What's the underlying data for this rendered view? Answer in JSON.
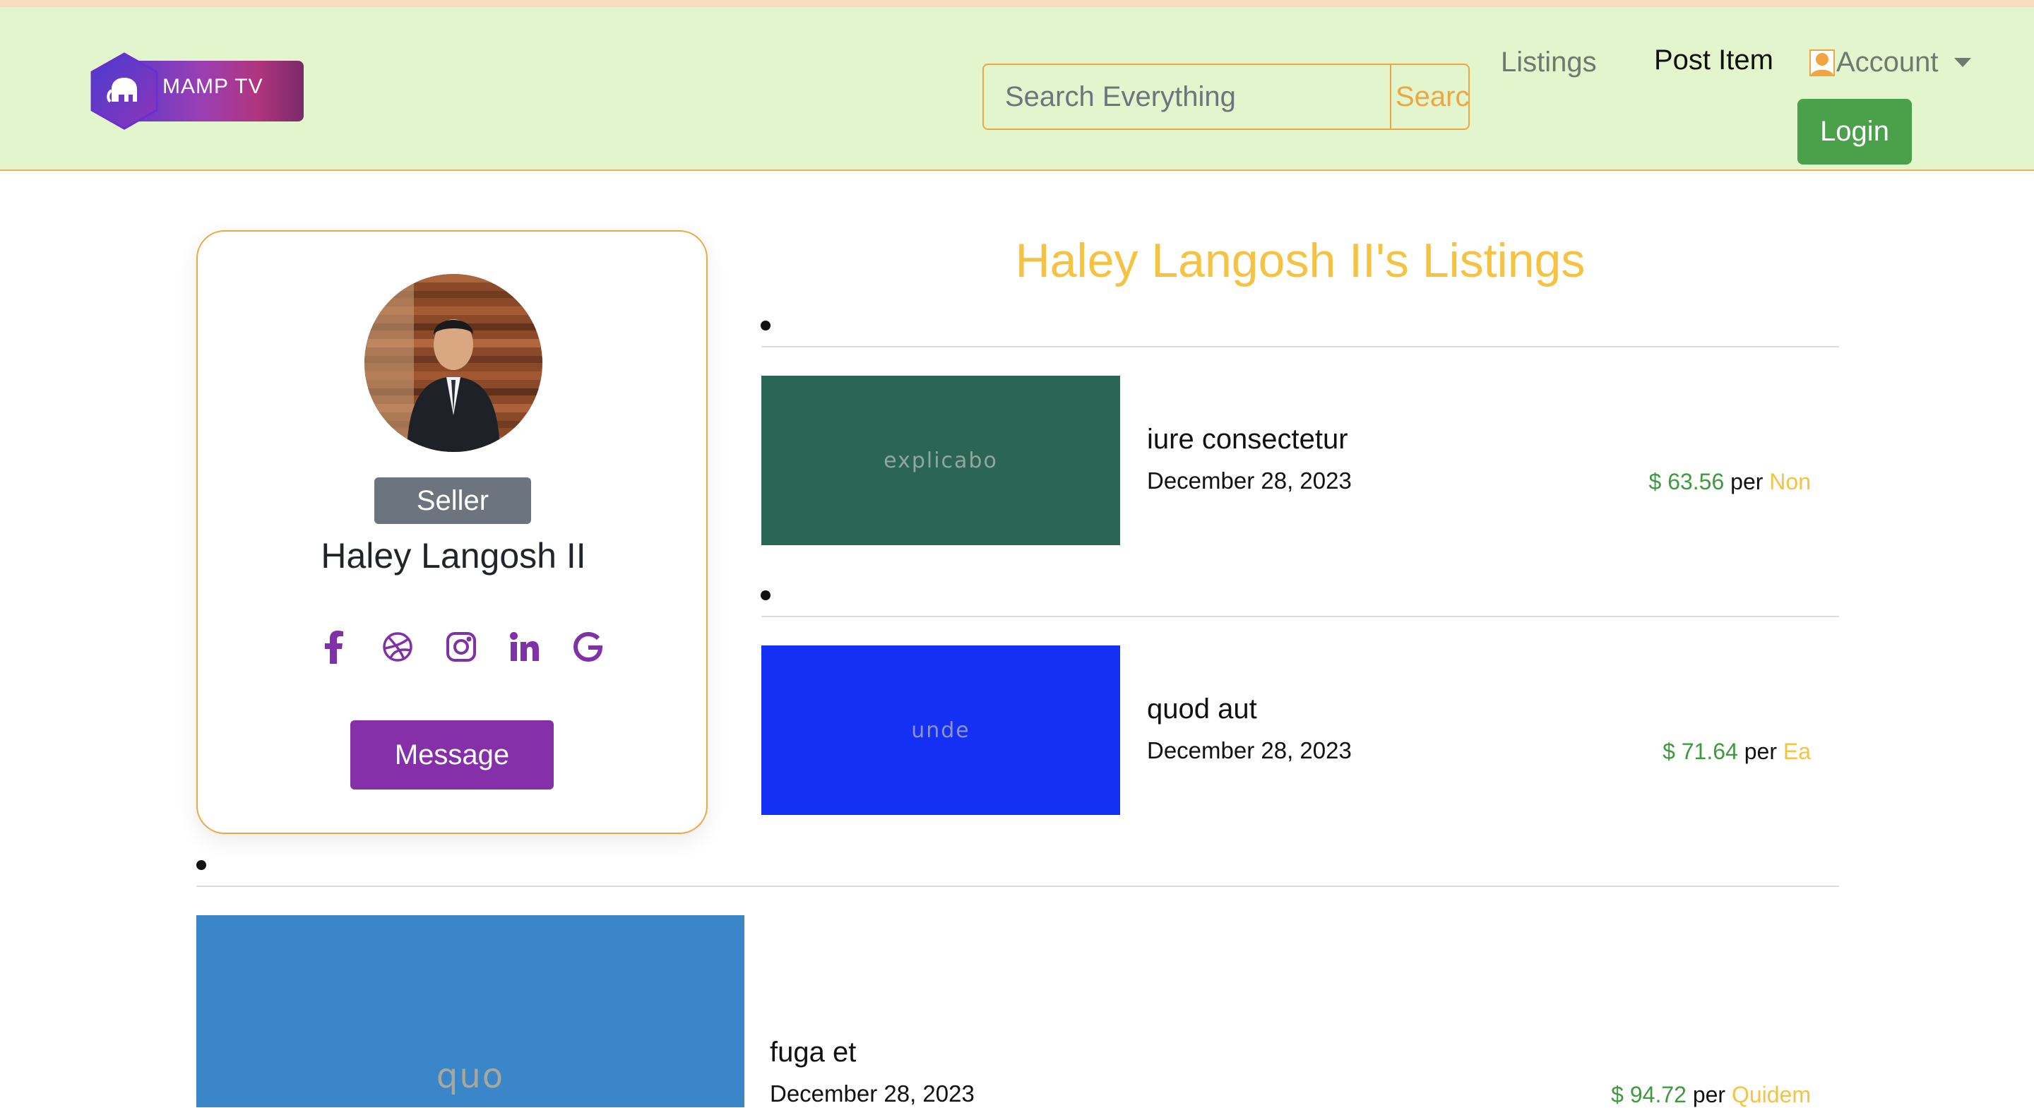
{
  "theme": {
    "navbar_bg": "#e3f5cd",
    "accent_orange": "#f0a640",
    "title_yellow": "#f5c242",
    "login_green": "#4aa14a",
    "message_purple": "#8530a8",
    "price_green": "#3f9a3f"
  },
  "navbar": {
    "brand": "MAMP TV",
    "search_placeholder": "Search Everything",
    "search_button": "Search",
    "links": {
      "listings": "Listings",
      "post_item": "Post Item",
      "account": "Account"
    },
    "login_button": "Login"
  },
  "profile": {
    "badge": "Seller",
    "name": "Haley Langosh II",
    "socials": [
      "facebook-icon",
      "dribbble-icon",
      "instagram-icon",
      "linkedin-icon",
      "google-icon"
    ],
    "message_button": "Message"
  },
  "listings": {
    "title": "Haley Langosh II's Listings",
    "items": [
      {
        "thumb_text": "explicabo",
        "thumb_bg": "#2b6655",
        "thumb_fg": "#8fa79c",
        "title": "iure consectetur",
        "date": "December 28, 2023",
        "price": "$ 63.56",
        "per": "per",
        "unit": "Non"
      },
      {
        "thumb_text": "unde",
        "thumb_bg": "#1530f5",
        "thumb_fg": "#8c93c6",
        "title": "quod aut",
        "date": "December 28, 2023",
        "price": "$ 71.64",
        "per": "per",
        "unit": "Ea"
      },
      {
        "thumb_text": "quo",
        "thumb_bg": "#3a86c8",
        "thumb_fg": "#a8a79a",
        "title": "fuga et",
        "date": "December 28, 2023",
        "price": "$ 94.72",
        "per": "per",
        "unit": "Quidem"
      }
    ]
  }
}
